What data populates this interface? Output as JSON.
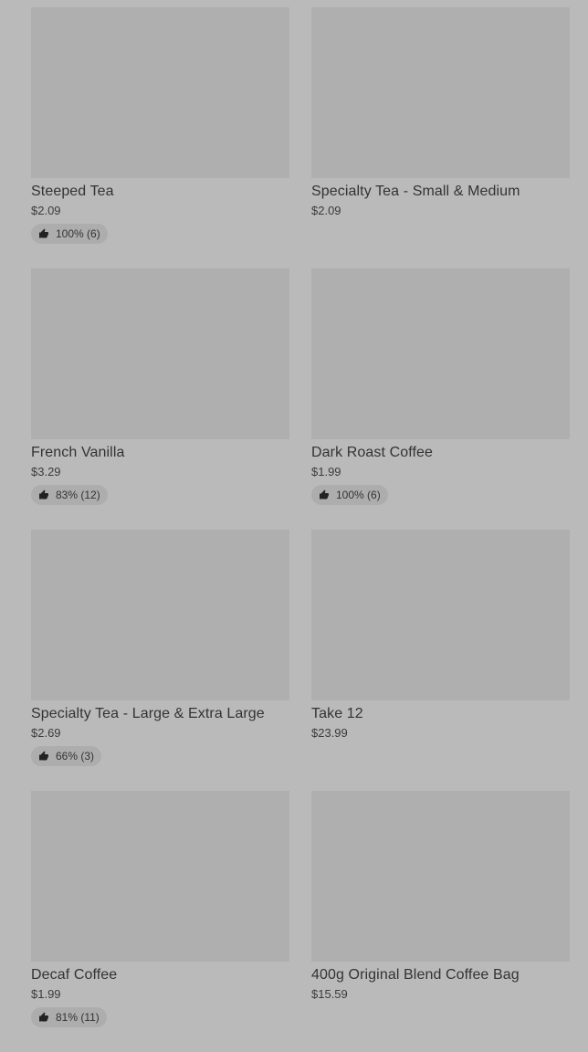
{
  "products": [
    {
      "name": "Steeped Tea",
      "price": "$2.09",
      "rating": "100% (6)"
    },
    {
      "name": "Specialty Tea - Small & Medium",
      "price": "$2.09",
      "rating": ""
    },
    {
      "name": "French Vanilla",
      "price": "$3.29",
      "rating": "83% (12)"
    },
    {
      "name": "Dark Roast Coffee",
      "price": "$1.99",
      "rating": "100% (6)"
    },
    {
      "name": "Specialty Tea - Large & Extra Large",
      "price": "$2.69",
      "rating": "66% (3)"
    },
    {
      "name": "Take 12",
      "price": "$23.99",
      "rating": ""
    },
    {
      "name": "Decaf Coffee",
      "price": "$1.99",
      "rating": "81% (11)"
    },
    {
      "name": "400g Original Blend Coffee Bag",
      "price": "$15.59",
      "rating": ""
    }
  ],
  "icons": {
    "rating": "thumbs-up-icon"
  },
  "colors": {
    "overlay": "#bababa",
    "thumb": "#afafaf",
    "text": "#333333"
  }
}
